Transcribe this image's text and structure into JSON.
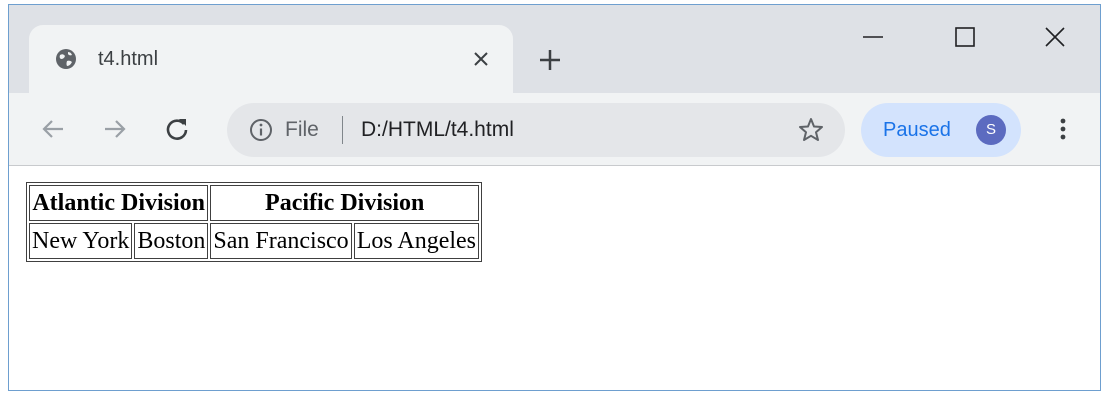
{
  "tab": {
    "title": "t4.html"
  },
  "address_bar": {
    "scheme_label": "File",
    "url": "D:/HTML/t4.html"
  },
  "profile": {
    "status": "Paused",
    "initial": "S"
  },
  "page": {
    "table": {
      "headers": [
        "Atlantic Division",
        "Pacific Division"
      ],
      "cities": [
        "New York",
        "Boston",
        "San Francisco",
        "Los Angeles"
      ]
    }
  },
  "colors": {
    "tabstrip": "#dee1e6",
    "toolbar": "#f1f3f4",
    "profile_chip": "#d3e3fd",
    "avatar": "#5c6bc0",
    "accent_text": "#1a73e8"
  },
  "icons": {
    "favicon": "globe-icon",
    "tab_close": "close-icon",
    "new_tab": "plus-icon",
    "minimize": "minimize-icon",
    "maximize": "maximize-icon",
    "close_window": "close-icon",
    "back": "back-arrow-icon",
    "forward": "forward-arrow-icon",
    "reload": "reload-icon",
    "site_info": "info-icon",
    "bookmark": "star-icon",
    "menu": "kebab-menu-icon"
  }
}
